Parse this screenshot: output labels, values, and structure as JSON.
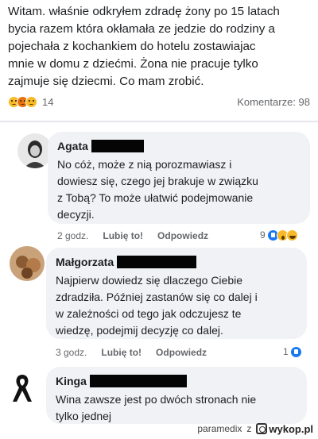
{
  "post": {
    "lines": [
      "Witam. właśnie odkryłem zdradę żony po 15 latach",
      "bycia razem która okłamała  ze jedzie do rodziny a",
      "pojechała z kochankiem do hotelu zostawiajac",
      "mnie w domu z dziećmi. Żona nie pracuje tylko",
      "zajmuje się dziecmi. Co mam zrobić."
    ],
    "reaction_count": "14",
    "comments_count": "Komentarze: 98"
  },
  "comments": [
    {
      "author": "Agata",
      "lines": [
        "No cóż, może z nią porozmawiasz i",
        "dowiesz się, czego jej brakuje w związku",
        "z Tobą? To może ułatwić podejmowanie",
        "decyzji."
      ],
      "time": "2 godz.",
      "like": "Lubię to!",
      "reply": "Odpowiedz",
      "reaction_count": "9"
    },
    {
      "author": "Małgorzata",
      "lines": [
        "Najpierw dowiedz się dlaczego Ciebie",
        "zdradziła. Później zastanów się co dalej i",
        "w zależności od tego jak odczujesz te",
        "wiedzę, podejmij decyzję co dalej."
      ],
      "time": "3 godz.",
      "like": "Lubię to!",
      "reply": "Odpowiedz",
      "reaction_count": "1"
    },
    {
      "author": "Kinga",
      "lines": [
        "Wina zawsze jest po dwóch stronach nie",
        "tylko jednej"
      ]
    }
  ],
  "footer": {
    "username": "paramedix",
    "z": "z",
    "logo": "wykop.pl"
  },
  "colors": {
    "bubble": "#f0f2f5",
    "muted": "#65676b",
    "like_blue": "#1877f2",
    "emoji_yellow": "#f7b928"
  }
}
